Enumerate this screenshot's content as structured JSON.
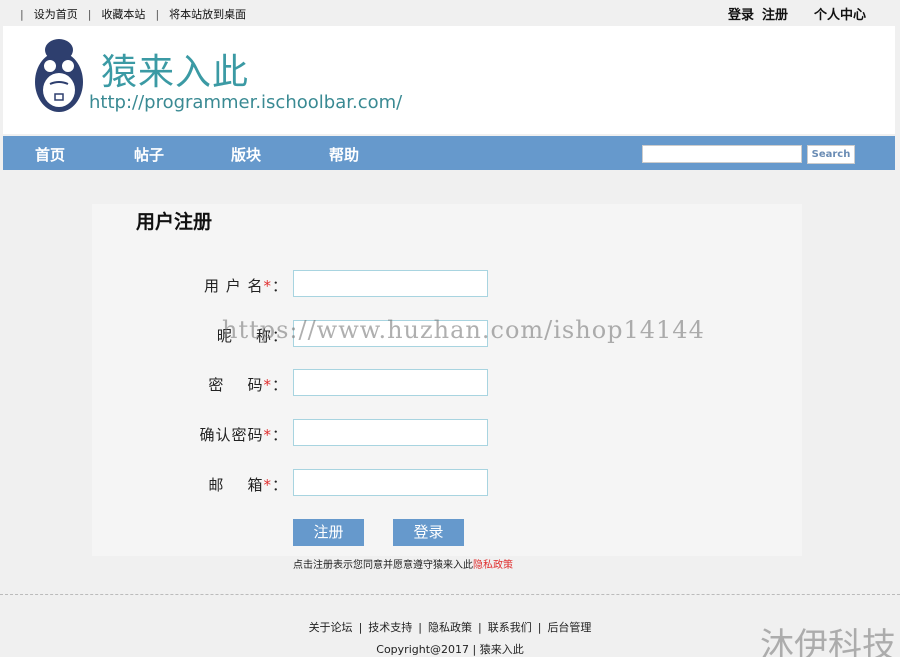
{
  "topbar": {
    "links": [
      "设为首页",
      "收藏本站",
      "将本站放到桌面"
    ],
    "login": "登录",
    "register": "注册",
    "user_center": "个人中心"
  },
  "header": {
    "title": "猿来入此",
    "url": "http://programmer.ischoolbar.com/"
  },
  "nav": {
    "items": [
      "首页",
      "帖子",
      "版块",
      "帮助"
    ],
    "search_button": "Search",
    "search_value": ""
  },
  "form": {
    "title": "用户注册",
    "fields": [
      {
        "label": "用 户 名",
        "required": true,
        "value": ""
      },
      {
        "label": "昵    称",
        "required": false,
        "value": ""
      },
      {
        "label": "密    码",
        "required": true,
        "value": ""
      },
      {
        "label": "确认密码",
        "required": true,
        "value": ""
      },
      {
        "label": "邮    箱",
        "required": true,
        "value": ""
      }
    ],
    "required_mark": "*",
    "colon": "：",
    "register_button": "注册",
    "login_button": "登录",
    "notice_text": "点击注册表示您同意并愿意遵守猿来入此",
    "notice_link": "隐私政策"
  },
  "footer": {
    "links": [
      "关于论坛",
      "技术支持",
      "隐私政策",
      "联系我们",
      "后台管理"
    ],
    "copyright": "Copyright@2017 | 猿来入此"
  },
  "watermark": "https://www.huzhan.com/ishop14144",
  "corner_mark": "沐伊科技",
  "colors": {
    "nav": "#6699cc",
    "brand": "#3b9aa4",
    "required": "#e03030"
  }
}
